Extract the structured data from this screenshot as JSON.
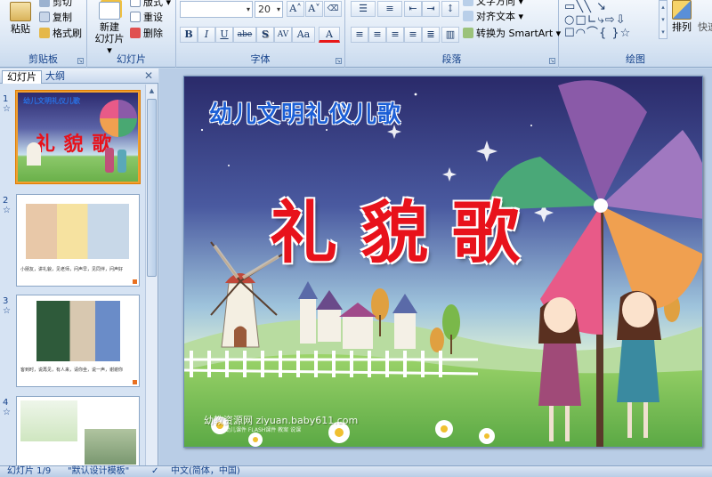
{
  "ribbon": {
    "clipboard": {
      "label": "剪贴板",
      "paste": "粘贴",
      "cut": "剪切",
      "copy": "复制",
      "format_painter": "格式刷"
    },
    "slides": {
      "label": "幻灯片",
      "new_slide": "新建",
      "new_slide_line2": "幻灯片 ▾",
      "layout": "版式 ▾",
      "reset": "重设",
      "delete": "删除"
    },
    "font": {
      "label": "字体",
      "font_name": "",
      "font_size": "20",
      "bold": "B",
      "italic": "I",
      "underline": "U",
      "strikethrough": "abe",
      "shadow": "S",
      "char_spacing": "AV",
      "change_case": "Aa",
      "font_color": "A",
      "grow": "A",
      "shrink": "A"
    },
    "paragraph": {
      "label": "段落",
      "text_direction": "文字方向 ▾",
      "align_text": "对齐文本 ▾",
      "smartart": "转换为 SmartArt ▾"
    },
    "drawing": {
      "label": "绘图",
      "arrange": "排列",
      "quick_styles": "快速"
    }
  },
  "left_pane": {
    "tabs": [
      "幻灯片",
      "大纲"
    ],
    "thumbnails": [
      {
        "num": "1",
        "title": "幼儿文明礼仪儿歌",
        "big": "礼 貌 歌"
      },
      {
        "num": "2",
        "caption": "小朋友，讲礼貌，见老师，问声早，见同伴，问声好"
      },
      {
        "num": "3",
        "caption": "客到时，说再见，有人来，请你坐，说一声，谢谢你"
      },
      {
        "num": "4",
        "caption": ""
      }
    ]
  },
  "slide": {
    "subtitle": "幼儿文明礼仪儿歌",
    "title": "礼 貌 歌",
    "watermark": "幼教资源网 ziyuan.baby611.com",
    "watermark_small": "幼儿课件 FLASH课件 教案 说课"
  },
  "status": {
    "slide_info": "幻灯片 1/9",
    "theme": "\"默认设计模板\"",
    "language": "中文(简体，中国)"
  },
  "colors": {
    "ribbon_bg": "#dae6f4",
    "accent": "#15428b",
    "title_red": "#e8121b",
    "subtitle_blue": "#1c5fd6"
  }
}
